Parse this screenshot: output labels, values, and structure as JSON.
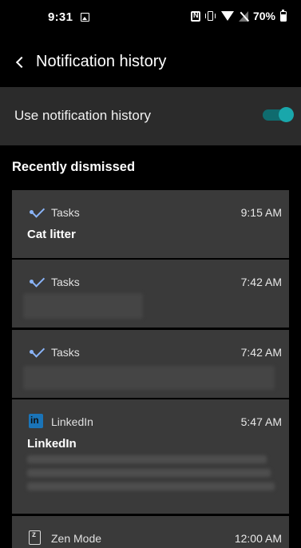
{
  "status_bar": {
    "time": "9:31",
    "battery": "70%",
    "icons": [
      "image-icon",
      "nfc-icon",
      "vibrate-icon",
      "wifi-icon",
      "signal-icon",
      "battery-icon"
    ]
  },
  "header": {
    "title": "Notification history"
  },
  "settings": {
    "use_history_label": "Use notification history",
    "use_history_enabled": true
  },
  "section": {
    "recently_dismissed": "Recently dismissed"
  },
  "notifications": [
    {
      "app": "Tasks",
      "time": "9:15 AM",
      "title": "Cat litter",
      "icon": "tasks-icon"
    },
    {
      "app": "Tasks",
      "time": "7:42 AM",
      "title": "",
      "icon": "tasks-icon"
    },
    {
      "app": "Tasks",
      "time": "7:42 AM",
      "title": "",
      "icon": "tasks-icon"
    },
    {
      "app": "LinkedIn",
      "time": "5:47 AM",
      "title": "LinkedIn",
      "icon": "linkedin-icon"
    },
    {
      "app": "Zen Mode",
      "time": "12:00 AM",
      "title": "",
      "icon": "zen-mode-icon"
    }
  ],
  "colors": {
    "background": "#000000",
    "surface": "#2b2b2b",
    "card": "#3a3a3a",
    "accent": "#19a7ab",
    "tasks_blue": "#8ab4f8",
    "linkedin_blue": "#1a74b8"
  }
}
